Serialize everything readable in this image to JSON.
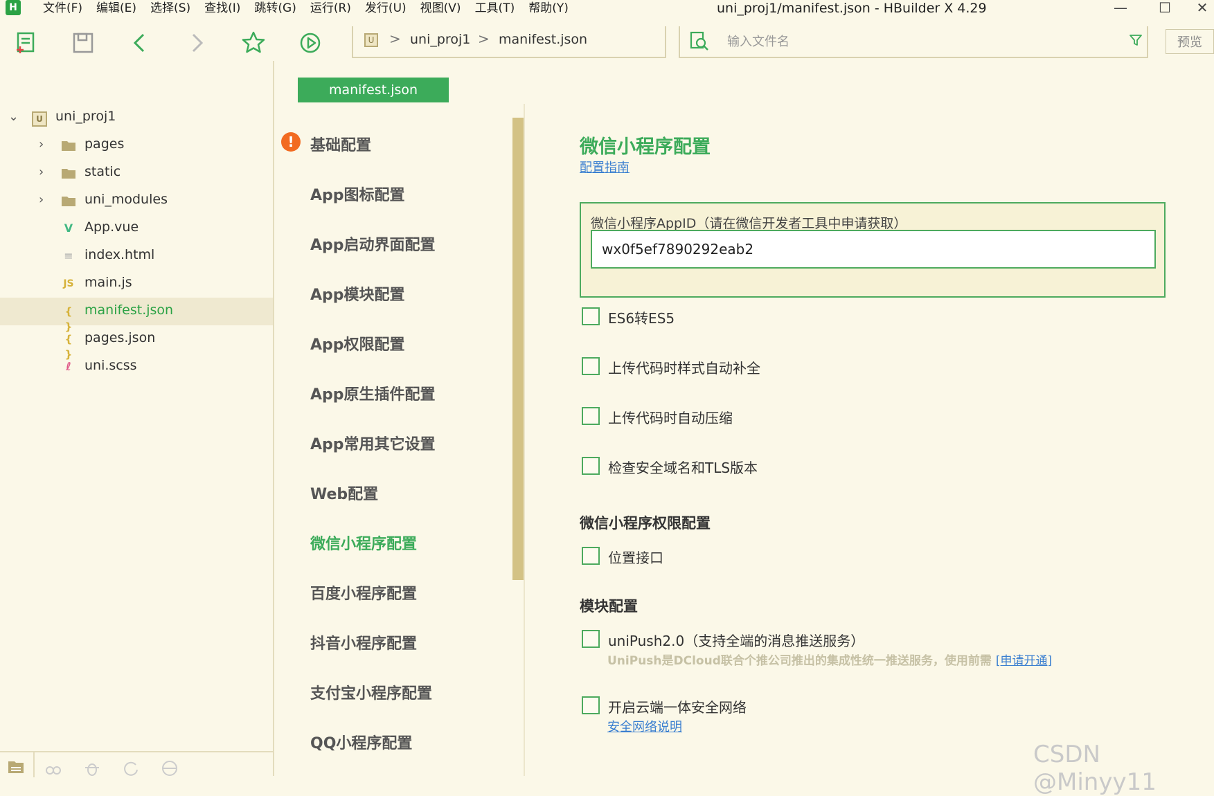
{
  "app": {
    "logo": "H",
    "window_title": "uni_proj1/manifest.json - HBuilder X 4.29"
  },
  "menu": [
    "文件(F)",
    "编辑(E)",
    "选择(S)",
    "查找(I)",
    "跳转(G)",
    "运行(R)",
    "发行(U)",
    "视图(V)",
    "工具(T)",
    "帮助(Y)"
  ],
  "window_controls": {
    "minimize": "—",
    "maximize": "☐",
    "close": "✕"
  },
  "toolbar": {
    "icons": [
      "new-file-icon",
      "save-icon",
      "back-icon",
      "forward-icon",
      "star-icon",
      "run-icon"
    ]
  },
  "breadcrumb": {
    "project_icon": "U",
    "project": "uni_proj1",
    "file": "manifest.json",
    "sep": ">"
  },
  "search": {
    "placeholder": "输入文件名",
    "preview_label": "预览"
  },
  "file_tree": {
    "root": "uni_proj1",
    "root_icon": "U",
    "items": [
      {
        "label": "pages",
        "type": "folder"
      },
      {
        "label": "static",
        "type": "folder"
      },
      {
        "label": "uni_modules",
        "type": "folder"
      },
      {
        "label": "App.vue",
        "type": "vue",
        "icon": "V"
      },
      {
        "label": "index.html",
        "type": "html",
        "icon": "≡"
      },
      {
        "label": "main.js",
        "type": "js",
        "icon": "JS"
      },
      {
        "label": "manifest.json",
        "type": "json",
        "icon": "{ }",
        "selected": true
      },
      {
        "label": "pages.json",
        "type": "json",
        "icon": "{ }"
      },
      {
        "label": "uni.scss",
        "type": "scss",
        "icon": "ℓ"
      }
    ]
  },
  "editor_tab": "manifest.json",
  "config_nav": {
    "warning_icon": "!",
    "items": [
      "基础配置",
      "App图标配置",
      "App启动界面配置",
      "App模块配置",
      "App权限配置",
      "App原生插件配置",
      "App常用其它设置",
      "Web配置",
      "微信小程序配置",
      "百度小程序配置",
      "抖音小程序配置",
      "支付宝小程序配置",
      "QQ小程序配置"
    ],
    "active_index": 8
  },
  "content": {
    "title": "微信小程序配置",
    "guide_link": "配置指南",
    "appid_label": "微信小程序AppID（请在微信开发者工具中申请获取）",
    "appid_value": "wx0f5ef7890292eab2",
    "checkboxes": [
      "ES6转ES5",
      "上传代码时样式自动补全",
      "上传代码时自动压缩",
      "检查安全域名和TLS版本"
    ],
    "permission_heading": "微信小程序权限配置",
    "permission_checkbox": "位置接口",
    "module_heading": "模块配置",
    "unipush_label": "uniPush2.0（支持全端的消息推送服务）",
    "unipush_desc": "UniPush是DCloud联合个推公司推出的集成性统一推送服务，使用前需",
    "unipush_link": "[申请开通]",
    "network_label": "开启云端一体安全网络",
    "network_link": "安全网络说明"
  },
  "watermark": "CSDN @Minyy11",
  "colors": {
    "accent": "#3cab5a",
    "link": "#3b7fd0",
    "background": "#fbf8e8",
    "warning": "#f26b21"
  }
}
